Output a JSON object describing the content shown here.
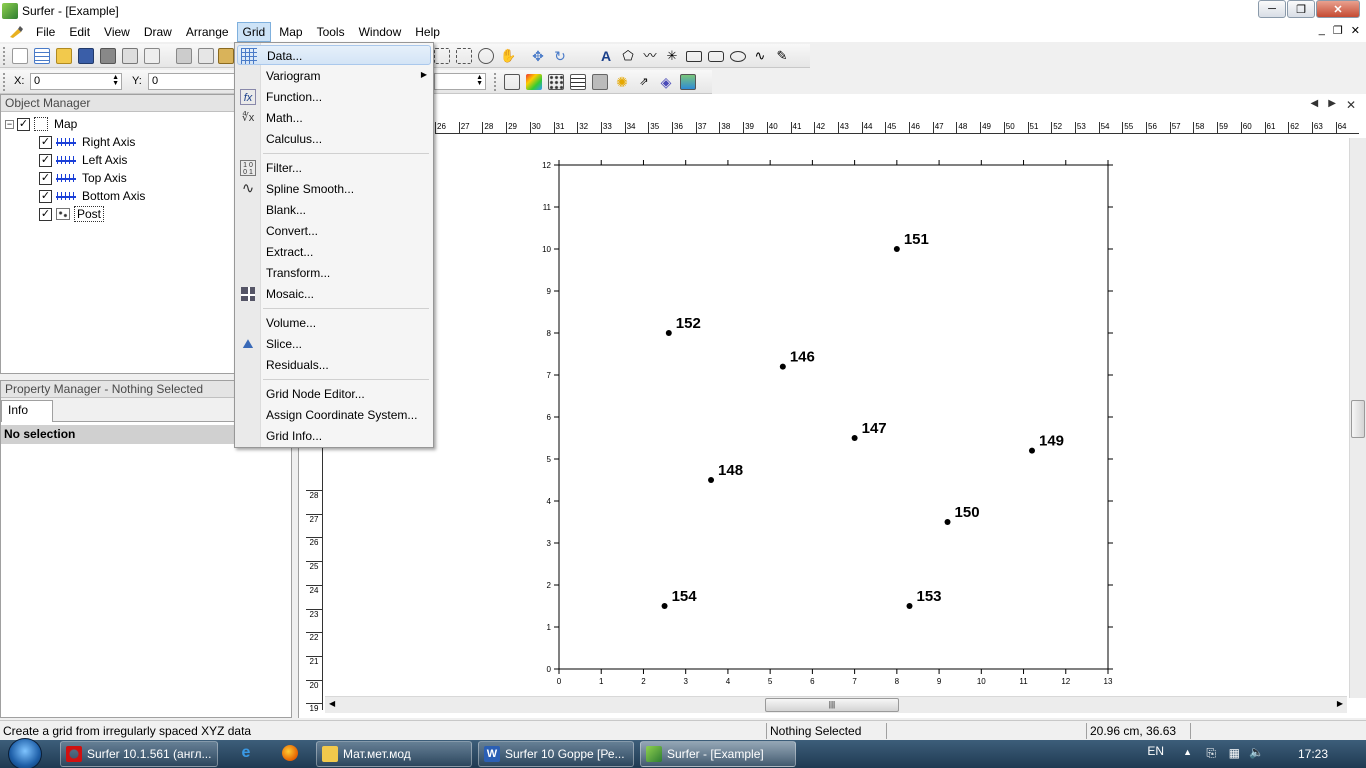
{
  "window": {
    "title": "Surfer - [Example]",
    "controls": {
      "minimize": "─",
      "maximize": "❐",
      "close": "✕"
    },
    "mdi_controls": {
      "minimize": "_",
      "restore": "❐",
      "close": "✕"
    }
  },
  "menubar": {
    "items": [
      "File",
      "Edit",
      "View",
      "Draw",
      "Arrange",
      "Grid",
      "Map",
      "Tools",
      "Window",
      "Help"
    ],
    "active": "Grid"
  },
  "coords": {
    "x_label": "X:",
    "x_value": "0",
    "y_label": "Y:",
    "y_value": "0"
  },
  "object_manager": {
    "title": "Object Manager",
    "root": "Map",
    "children": [
      "Right Axis",
      "Left Axis",
      "Top Axis",
      "Bottom Axis",
      "Post"
    ]
  },
  "property_manager": {
    "title": "Property Manager - Nothing Selected",
    "tab": "Info",
    "selection_text": "No selection"
  },
  "grid_menu": {
    "groups": [
      [
        "Data...",
        "Variogram",
        "Function...",
        "Math...",
        "Calculus..."
      ],
      [
        "Filter...",
        "Spline Smooth...",
        "Blank...",
        "Convert...",
        "Extract...",
        "Transform...",
        "Mosaic..."
      ],
      [
        "Volume...",
        "Slice...",
        "Residuals..."
      ],
      [
        "Grid Node Editor...",
        "Assign Coordinate System...",
        "Grid Info..."
      ]
    ]
  },
  "rulers": {
    "top_labels": [
      "26",
      "27",
      "28",
      "29",
      "30",
      "31",
      "32",
      "33",
      "34",
      "35",
      "36",
      "37",
      "38",
      "39",
      "40",
      "41",
      "42",
      "43",
      "44",
      "45",
      "46",
      "47",
      "48",
      "49",
      "50",
      "51",
      "52",
      "53",
      "54",
      "55",
      "56",
      "57",
      "58",
      "59",
      "60",
      "61",
      "62",
      "63",
      "64"
    ],
    "left_labels": [
      "28",
      "27",
      "26",
      "25",
      "24",
      "23",
      "22",
      "21",
      "20",
      "19"
    ]
  },
  "chart_data": {
    "type": "scatter",
    "xlim": [
      0,
      13
    ],
    "ylim": [
      0,
      12
    ],
    "x_ticks": [
      0,
      1,
      2,
      3,
      4,
      5,
      6,
      7,
      8,
      9,
      10,
      11,
      12,
      13
    ],
    "y_ticks": [
      0,
      1,
      2,
      3,
      4,
      5,
      6,
      7,
      8,
      9,
      10,
      11,
      12
    ],
    "points": [
      {
        "label": "151",
        "x": 8.0,
        "y": 10.0
      },
      {
        "label": "152",
        "x": 2.6,
        "y": 8.0
      },
      {
        "label": "146",
        "x": 5.3,
        "y": 7.2
      },
      {
        "label": "147",
        "x": 7.0,
        "y": 5.5
      },
      {
        "label": "149",
        "x": 11.2,
        "y": 5.2
      },
      {
        "label": "148",
        "x": 3.6,
        "y": 4.5
      },
      {
        "label": "150",
        "x": 9.2,
        "y": 3.5
      },
      {
        "label": "154",
        "x": 2.5,
        "y": 1.5
      },
      {
        "label": "153",
        "x": 8.3,
        "y": 1.5
      }
    ],
    "grid": false,
    "marker_color": "#000000"
  },
  "statusbar": {
    "hint": "Create a grid from irregularly spaced XYZ data",
    "selection": "Nothing Selected",
    "position": "20.96 cm, 36.63 cm"
  },
  "taskbar": {
    "tasks": [
      "Surfer 10.1.561 (англ...",
      "Мат.мет.мод",
      "Surfer 10 Goppe [Ре...",
      "Surfer - [Example]"
    ],
    "language": "EN",
    "time": "17:23"
  },
  "colors": {
    "accent": "#cde3f7",
    "axis_icon": "#1a3fd8",
    "taskbar": "#1f3a52"
  }
}
